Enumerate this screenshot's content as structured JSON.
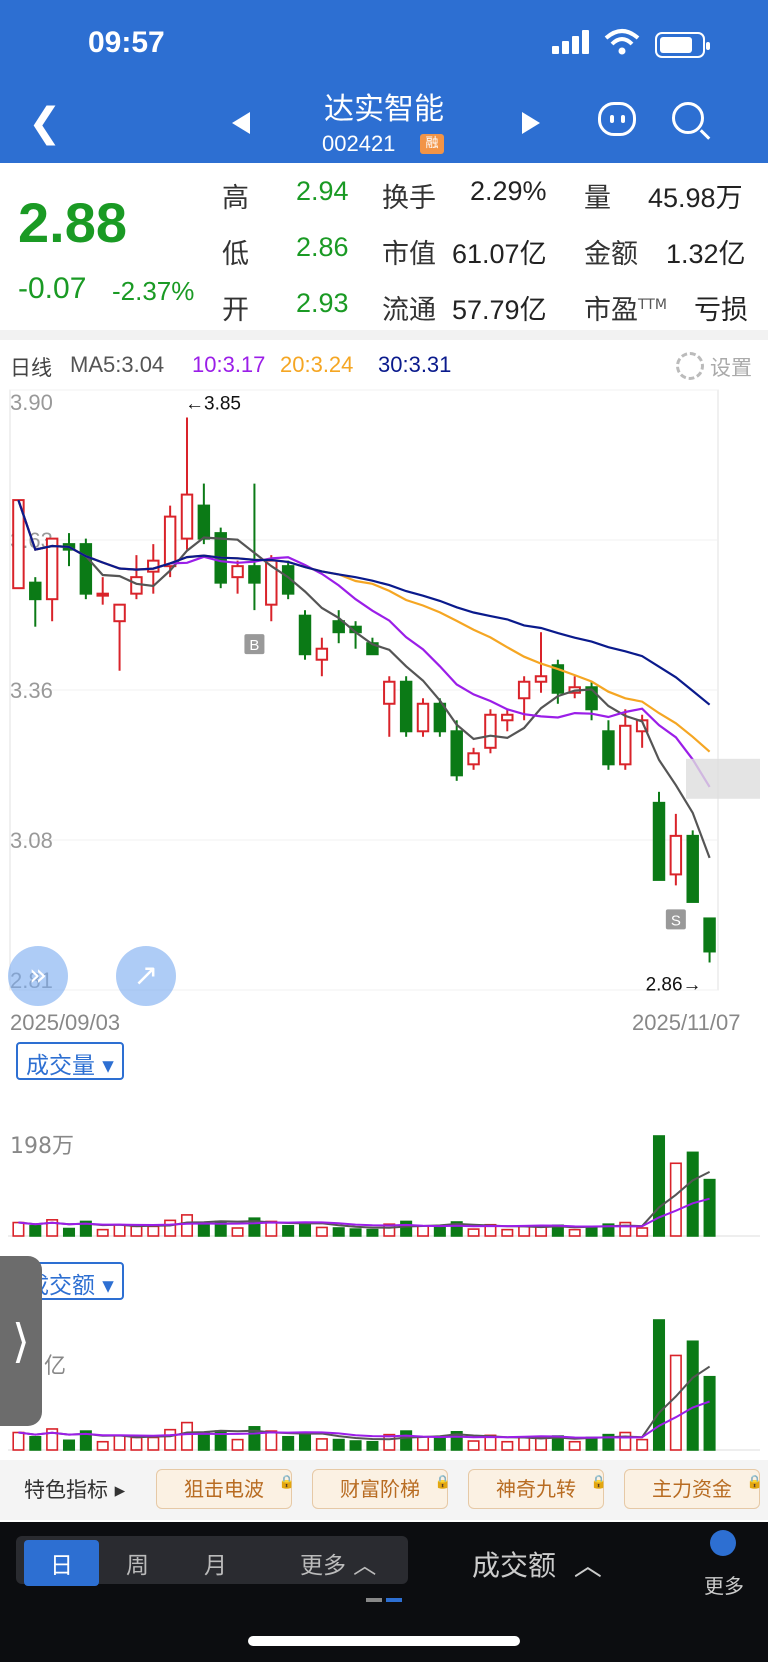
{
  "status": {
    "time": "09:57"
  },
  "header": {
    "name": "达实智能",
    "code": "002421",
    "badge": "融"
  },
  "quote": {
    "price": "2.88",
    "change": "-0.07",
    "change_pct": "-2.37%",
    "high_label": "高",
    "high": "2.94",
    "low_label": "低",
    "low": "2.86",
    "open_label": "开",
    "open": "2.93",
    "turnover_label": "换手",
    "turnover": "2.29%",
    "mcap_label": "市值",
    "mcap": "61.07亿",
    "float_label": "流通",
    "float": "57.79亿",
    "vol_label": "量",
    "vol": "45.98万",
    "amount_label": "金额",
    "amount": "1.32亿",
    "pe_label": "市盈",
    "pe_sup": "TTM",
    "pe": "亏损"
  },
  "ma": {
    "period": "日线",
    "ma5": "MA5:3.04",
    "ma10": "10:3.17",
    "ma20": "20:3.24",
    "ma30": "30:3.31",
    "settings": "设置",
    "colors": {
      "ma5": "#555555",
      "ma10": "#9b1ee8",
      "ma20": "#f5a623",
      "ma30": "#0a1a8c",
      "up": "#d9232a",
      "down": "#0b7a16"
    }
  },
  "chart": {
    "y_ticks": [
      "3.90",
      "3.63",
      "3.36",
      "3.08",
      "2.81"
    ],
    "high_mark": "←3.85",
    "low_mark": "2.86→",
    "buy_mark": "B",
    "sell_mark": "S",
    "date_start": "2025/09/03",
    "date_end": "2025/11/07"
  },
  "chart_data": {
    "type": "candlestick",
    "date_range": [
      "2025/09/03",
      "2025/11/07"
    ],
    "ylim": [
      2.81,
      3.9
    ],
    "candles": [
      {
        "o": 3.54,
        "h": 3.56,
        "l": 3.54,
        "c": 3.7
      },
      {
        "o": 3.55,
        "h": 3.56,
        "l": 3.47,
        "c": 3.52
      },
      {
        "o": 3.52,
        "h": 3.6,
        "l": 3.48,
        "c": 3.63
      },
      {
        "o": 3.62,
        "h": 3.64,
        "l": 3.58,
        "c": 3.61
      },
      {
        "o": 3.62,
        "h": 3.63,
        "l": 3.52,
        "c": 3.53
      },
      {
        "o": 3.53,
        "h": 3.56,
        "l": 3.51,
        "c": 3.53
      },
      {
        "o": 3.48,
        "h": 3.5,
        "l": 3.39,
        "c": 3.51
      },
      {
        "o": 3.53,
        "h": 3.6,
        "l": 3.52,
        "c": 3.56
      },
      {
        "o": 3.57,
        "h": 3.62,
        "l": 3.53,
        "c": 3.59
      },
      {
        "o": 3.58,
        "h": 3.69,
        "l": 3.56,
        "c": 3.67
      },
      {
        "o": 3.63,
        "h": 3.85,
        "l": 3.61,
        "c": 3.71
      },
      {
        "o": 3.69,
        "h": 3.73,
        "l": 3.62,
        "c": 3.63
      },
      {
        "o": 3.64,
        "h": 3.65,
        "l": 3.54,
        "c": 3.55
      },
      {
        "o": 3.56,
        "h": 3.59,
        "l": 3.53,
        "c": 3.58
      },
      {
        "o": 3.58,
        "h": 3.73,
        "l": 3.5,
        "c": 3.55
      },
      {
        "o": 3.51,
        "h": 3.6,
        "l": 3.48,
        "c": 3.59
      },
      {
        "o": 3.58,
        "h": 3.59,
        "l": 3.52,
        "c": 3.53
      },
      {
        "o": 3.49,
        "h": 3.5,
        "l": 3.41,
        "c": 3.42
      },
      {
        "o": 3.41,
        "h": 3.45,
        "l": 3.38,
        "c": 3.43
      },
      {
        "o": 3.48,
        "h": 3.5,
        "l": 3.44,
        "c": 3.46
      },
      {
        "o": 3.47,
        "h": 3.48,
        "l": 3.43,
        "c": 3.46
      },
      {
        "o": 3.44,
        "h": 3.45,
        "l": 3.42,
        "c": 3.42
      },
      {
        "o": 3.33,
        "h": 3.38,
        "l": 3.27,
        "c": 3.37
      },
      {
        "o": 3.37,
        "h": 3.38,
        "l": 3.27,
        "c": 3.28
      },
      {
        "o": 3.28,
        "h": 3.34,
        "l": 3.27,
        "c": 3.33
      },
      {
        "o": 3.33,
        "h": 3.34,
        "l": 3.27,
        "c": 3.28
      },
      {
        "o": 3.28,
        "h": 3.3,
        "l": 3.19,
        "c": 3.2
      },
      {
        "o": 3.22,
        "h": 3.25,
        "l": 3.21,
        "c": 3.24
      },
      {
        "o": 3.25,
        "h": 3.32,
        "l": 3.24,
        "c": 3.31
      },
      {
        "o": 3.3,
        "h": 3.32,
        "l": 3.28,
        "c": 3.31
      },
      {
        "o": 3.34,
        "h": 3.38,
        "l": 3.3,
        "c": 3.37
      },
      {
        "o": 3.37,
        "h": 3.46,
        "l": 3.35,
        "c": 3.38
      },
      {
        "o": 3.4,
        "h": 3.41,
        "l": 3.33,
        "c": 3.35
      },
      {
        "o": 3.35,
        "h": 3.38,
        "l": 3.34,
        "c": 3.36
      },
      {
        "o": 3.36,
        "h": 3.37,
        "l": 3.3,
        "c": 3.32
      },
      {
        "o": 3.28,
        "h": 3.3,
        "l": 3.21,
        "c": 3.22
      },
      {
        "o": 3.22,
        "h": 3.32,
        "l": 3.21,
        "c": 3.29
      },
      {
        "o": 3.28,
        "h": 3.31,
        "l": 3.25,
        "c": 3.3
      },
      {
        "o": 3.15,
        "h": 3.17,
        "l": 3.01,
        "c": 3.01
      },
      {
        "o": 3.02,
        "h": 3.13,
        "l": 3.0,
        "c": 3.09
      },
      {
        "o": 3.09,
        "h": 3.1,
        "l": 2.98,
        "c": 2.97
      },
      {
        "o": 2.94,
        "h": 2.94,
        "l": 2.86,
        "c": 2.88
      }
    ],
    "volume_label": "成交量",
    "volume_tick": "198万",
    "amount_label": "成交额",
    "amount_tick": "亿"
  },
  "features": {
    "label": "特色指标",
    "items": [
      "狙击电波",
      "财富阶梯",
      "神奇九转",
      "主力资金"
    ]
  },
  "bottom": {
    "periods": [
      "日",
      "周",
      "月",
      "更多"
    ],
    "sub_indicator": "成交额",
    "more": "更多"
  }
}
